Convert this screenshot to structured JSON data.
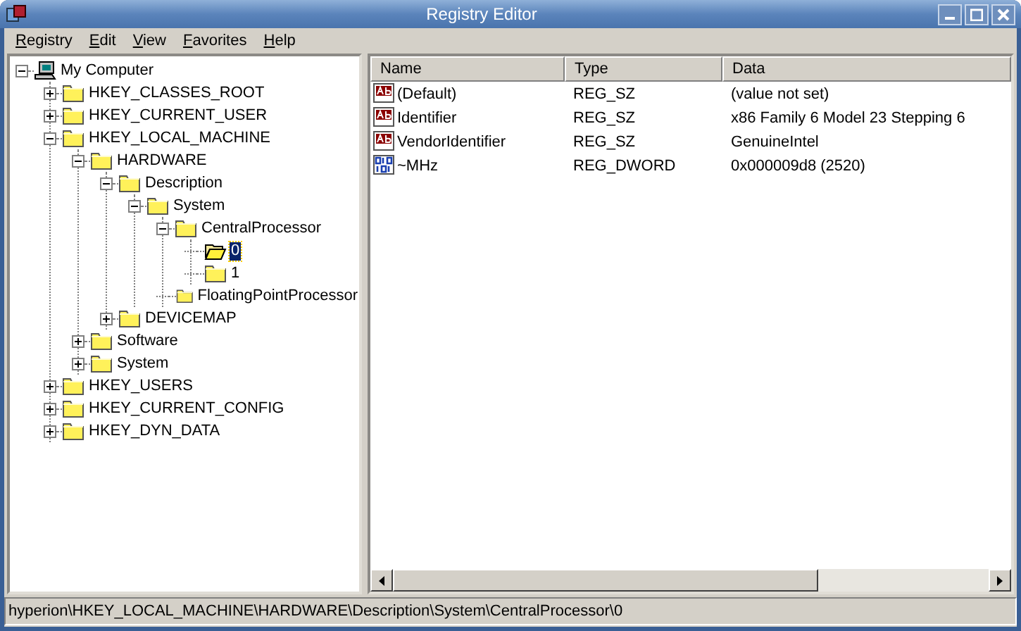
{
  "window": {
    "title": "Registry Editor"
  },
  "menu": [
    {
      "key": "R",
      "rest": "egistry"
    },
    {
      "key": "E",
      "rest": "dit"
    },
    {
      "key": "V",
      "rest": "iew"
    },
    {
      "key": "F",
      "rest": "avorites"
    },
    {
      "key": "H",
      "rest": "elp"
    }
  ],
  "tree": [
    {
      "label": "My Computer",
      "kind": "computer",
      "expanded": true,
      "selected": false,
      "children": [
        {
          "label": "HKEY_CLASSES_ROOT",
          "kind": "folder",
          "expanded": false,
          "selected": false
        },
        {
          "label": "HKEY_CURRENT_USER",
          "kind": "folder",
          "expanded": false,
          "selected": false
        },
        {
          "label": "HKEY_LOCAL_MACHINE",
          "kind": "folder",
          "expanded": true,
          "selected": false,
          "children": [
            {
              "label": "HARDWARE",
              "kind": "folder",
              "expanded": true,
              "selected": false,
              "children": [
                {
                  "label": "Description",
                  "kind": "folder",
                  "expanded": true,
                  "selected": false,
                  "children": [
                    {
                      "label": "System",
                      "kind": "folder",
                      "expanded": true,
                      "selected": false,
                      "children": [
                        {
                          "label": "CentralProcessor",
                          "kind": "folder",
                          "expanded": true,
                          "selected": false,
                          "children": [
                            {
                              "label": "0",
                              "kind": "folder",
                              "selected": true
                            },
                            {
                              "label": "1",
                              "kind": "folder",
                              "selected": false
                            }
                          ]
                        },
                        {
                          "label": "FloatingPointProcessor",
                          "kind": "folder",
                          "selected": false
                        }
                      ]
                    }
                  ]
                },
                {
                  "label": "DEVICEMAP",
                  "kind": "folder",
                  "expanded": false,
                  "selected": false
                }
              ]
            },
            {
              "label": "Software",
              "kind": "folder",
              "expanded": false,
              "selected": false
            },
            {
              "label": "System",
              "kind": "folder",
              "expanded": false,
              "selected": false
            }
          ]
        },
        {
          "label": "HKEY_USERS",
          "kind": "folder",
          "expanded": false,
          "selected": false
        },
        {
          "label": "HKEY_CURRENT_CONFIG",
          "kind": "folder",
          "expanded": false,
          "selected": false
        },
        {
          "label": "HKEY_DYN_DATA",
          "kind": "folder",
          "expanded": false,
          "selected": false
        }
      ]
    }
  ],
  "values": {
    "columns": [
      "Name",
      "Type",
      "Data"
    ],
    "rows": [
      {
        "kind": "string",
        "name": "(Default)",
        "type": "REG_SZ",
        "data": "(value not set)"
      },
      {
        "kind": "string",
        "name": "Identifier",
        "type": "REG_SZ",
        "data": "x86 Family 6 Model 23 Stepping 6"
      },
      {
        "kind": "string",
        "name": "VendorIdentifier",
        "type": "REG_SZ",
        "data": "GenuineIntel"
      },
      {
        "kind": "dword",
        "name": "~MHz",
        "type": "REG_DWORD",
        "data": "0x000009d8 (2520)"
      }
    ]
  },
  "status_bar": "hyperion\\HKEY_LOCAL_MACHINE\\HARDWARE\\Description\\System\\CentralProcessor\\0"
}
